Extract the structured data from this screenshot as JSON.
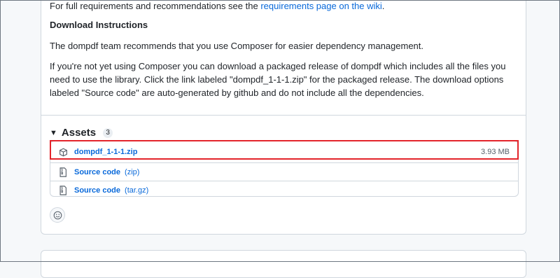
{
  "release": {
    "cut_line_prefix": "For full requirements and recommendations see the ",
    "cut_line_link": "requirements page on the wiki",
    "cut_line_suffix": ".",
    "heading": "Download Instructions",
    "para1": "The dompdf team recommends that you use Composer for easier dependency management.",
    "para2": "If you're not yet using Composer you can download a packaged release of dompdf which includes all the files you need to use the library. Click the link labeled \"dompdf_1-1-1.zip\" for the packaged release. The download options labeled \"Source code\" are auto-generated by github and do not include all the dependencies."
  },
  "assets": {
    "title": "Assets",
    "count": "3",
    "items": [
      {
        "name": "dompdf_1-1-1.zip",
        "ext": "",
        "size": "3.93 MB",
        "icon": "package-icon"
      },
      {
        "name": "Source code",
        "ext": "(zip)",
        "size": "",
        "icon": "file-zip-icon"
      },
      {
        "name": "Source code",
        "ext": "(tar.gz)",
        "size": "",
        "icon": "file-zip-icon"
      }
    ]
  },
  "colors": {
    "highlight": "#e3242b",
    "link": "#0969da"
  }
}
